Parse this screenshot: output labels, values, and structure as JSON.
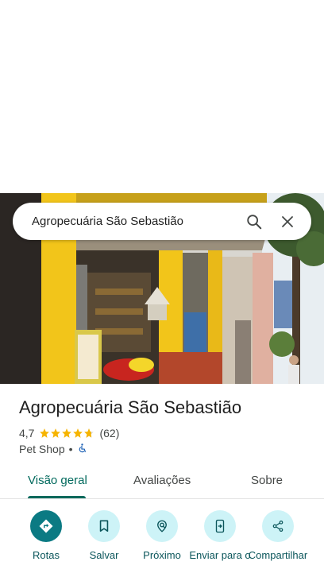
{
  "search": {
    "query": "Agropecuária São Sebastião",
    "search_icon": "search-icon",
    "close_icon": "close-icon"
  },
  "place": {
    "name": "Agropecuária São Sebastião",
    "rating": "4,7",
    "rating_value": 4.7,
    "review_count": "(62)",
    "category": "Pet Shop",
    "separator": "•",
    "accessibility_icon": "wheelchair-icon"
  },
  "tabs": [
    {
      "label": "Visão geral",
      "active": true
    },
    {
      "label": "Avaliações",
      "active": false
    },
    {
      "label": "Sobre",
      "active": false
    }
  ],
  "actions": [
    {
      "label": "Rotas",
      "icon": "directions-icon"
    },
    {
      "label": "Salvar",
      "icon": "bookmark-icon"
    },
    {
      "label": "Próximo",
      "icon": "nearby-icon"
    },
    {
      "label": "Enviar para o",
      "icon": "send-to-phone-icon"
    },
    {
      "label": "Compartilhar",
      "icon": "share-icon"
    }
  ],
  "colors": {
    "accent": "#00695c",
    "action_bg": "#cdf3f7",
    "action_primary": "#0b7a83",
    "star": "#f6b400"
  }
}
